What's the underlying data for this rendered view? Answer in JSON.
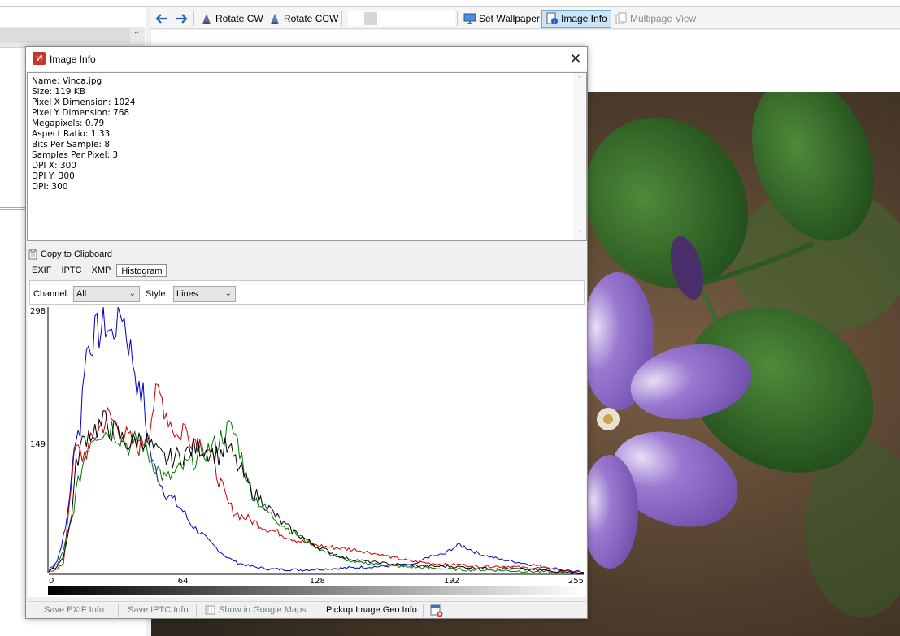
{
  "toolbar": {
    "back_icon": "arrow-left-icon",
    "forward_icon": "arrow-right-icon",
    "rotate_cw": "Rotate CW",
    "rotate_ccw": "Rotate CCW",
    "set_wallpaper": "Set Wallpaper",
    "image_info": "Image Info",
    "multipage_view": "Multipage View",
    "scroll_left": "<",
    "scroll_right": ">"
  },
  "dialog": {
    "title": "Image Info",
    "close_glyph": "✕",
    "info_lines": [
      "Name: Vinca.jpg",
      "Size: 119 KB",
      "Pixel X Dimension: 1024",
      "Pixel Y Dimension: 768",
      "Megapixels: 0.79",
      "Aspect Ratio: 1.33",
      "Bits Per Sample: 8",
      "Samples Per Pixel: 3",
      "DPI X: 300",
      "DPI Y: 300",
      "DPI: 300"
    ],
    "copy_to_clipboard": "Copy to Clipboard",
    "tabs": [
      "EXIF",
      "IPTC",
      "XMP",
      "Histogram"
    ],
    "active_tab": "Histogram",
    "channel_label": "Channel:",
    "channel_value": "All",
    "style_label": "Style:",
    "style_value": "Lines",
    "footer": {
      "save_exif": "Save EXIF Info",
      "save_iptc": "Save IPTC Info",
      "show_maps": "Show in Google Maps",
      "pickup_geo": "Pickup Image Geo Info"
    }
  },
  "chart_data": {
    "type": "line",
    "title": "",
    "xlabel": "",
    "ylabel": "",
    "xlim": [
      0,
      255
    ],
    "ylim": [
      0,
      298
    ],
    "x_ticks": [
      "0",
      "64",
      "128",
      "192",
      "255"
    ],
    "y_ticks": [
      "298",
      "149"
    ],
    "grid": false,
    "series": [
      {
        "color": "#0000cc",
        "points": [
          [
            0,
            4
          ],
          [
            4,
            14
          ],
          [
            8,
            50
          ],
          [
            11,
            110
          ],
          [
            13,
            160
          ],
          [
            15,
            160
          ],
          [
            17,
            240
          ],
          [
            19,
            255
          ],
          [
            21,
            265
          ],
          [
            24,
            270
          ],
          [
            27,
            280
          ],
          [
            30,
            265
          ],
          [
            33,
            290
          ],
          [
            35,
            296
          ],
          [
            37,
            270
          ],
          [
            39,
            250
          ],
          [
            41,
            230
          ],
          [
            43,
            200
          ],
          [
            45,
            200
          ],
          [
            46,
            170
          ],
          [
            48,
            140
          ],
          [
            50,
            120
          ],
          [
            52,
            110
          ],
          [
            54,
            98
          ],
          [
            56,
            90
          ],
          [
            60,
            80
          ],
          [
            64,
            70
          ],
          [
            67,
            58
          ],
          [
            70,
            50
          ],
          [
            73,
            44
          ],
          [
            76,
            36
          ],
          [
            80,
            28
          ],
          [
            85,
            18
          ],
          [
            90,
            12
          ],
          [
            96,
            8
          ],
          [
            105,
            5
          ],
          [
            120,
            4
          ],
          [
            140,
            6
          ],
          [
            160,
            8
          ],
          [
            175,
            10
          ],
          [
            180,
            18
          ],
          [
            185,
            20
          ],
          [
            189,
            22
          ],
          [
            192,
            28
          ],
          [
            196,
            32
          ],
          [
            200,
            28
          ],
          [
            205,
            22
          ],
          [
            215,
            16
          ],
          [
            225,
            12
          ],
          [
            235,
            8
          ],
          [
            245,
            4
          ],
          [
            252,
            2
          ],
          [
            255,
            0
          ]
        ]
      },
      {
        "color": "#cc0000",
        "points": [
          [
            0,
            2
          ],
          [
            4,
            6
          ],
          [
            7,
            10
          ],
          [
            9,
            60
          ],
          [
            11,
            110
          ],
          [
            13,
            140
          ],
          [
            16,
            130
          ],
          [
            19,
            140
          ],
          [
            22,
            155
          ],
          [
            25,
            165
          ],
          [
            28,
            175
          ],
          [
            31,
            170
          ],
          [
            34,
            160
          ],
          [
            38,
            150
          ],
          [
            42,
            140
          ],
          [
            46,
            150
          ],
          [
            48,
            165
          ],
          [
            50,
            190
          ],
          [
            52,
            200
          ],
          [
            54,
            195
          ],
          [
            56,
            180
          ],
          [
            58,
            170
          ],
          [
            60,
            160
          ],
          [
            62,
            150
          ],
          [
            64,
            165
          ],
          [
            67,
            155
          ],
          [
            70,
            150
          ],
          [
            73,
            145
          ],
          [
            76,
            140
          ],
          [
            79,
            120
          ],
          [
            82,
            100
          ],
          [
            85,
            80
          ],
          [
            88,
            70
          ],
          [
            92,
            64
          ],
          [
            96,
            60
          ],
          [
            100,
            55
          ],
          [
            104,
            50
          ],
          [
            110,
            45
          ],
          [
            115,
            40
          ],
          [
            120,
            36
          ],
          [
            126,
            32
          ],
          [
            132,
            30
          ],
          [
            140,
            28
          ],
          [
            148,
            26
          ],
          [
            156,
            22
          ],
          [
            164,
            18
          ],
          [
            172,
            14
          ],
          [
            180,
            12
          ],
          [
            188,
            10
          ],
          [
            196,
            10
          ],
          [
            204,
            8
          ],
          [
            212,
            8
          ],
          [
            220,
            8
          ],
          [
            228,
            6
          ],
          [
            236,
            6
          ],
          [
            244,
            4
          ],
          [
            255,
            0
          ]
        ]
      },
      {
        "color": "#007700",
        "points": [
          [
            0,
            2
          ],
          [
            4,
            10
          ],
          [
            7,
            25
          ],
          [
            9,
            45
          ],
          [
            11,
            60
          ],
          [
            13,
            90
          ],
          [
            15,
            110
          ],
          [
            18,
            140
          ],
          [
            21,
            155
          ],
          [
            24,
            160
          ],
          [
            27,
            158
          ],
          [
            30,
            165
          ],
          [
            33,
            155
          ],
          [
            36,
            148
          ],
          [
            39,
            140
          ],
          [
            42,
            150
          ],
          [
            45,
            145
          ],
          [
            48,
            130
          ],
          [
            51,
            120
          ],
          [
            54,
            110
          ],
          [
            56,
            105
          ],
          [
            59,
            110
          ],
          [
            62,
            115
          ],
          [
            65,
            120
          ],
          [
            68,
            125
          ],
          [
            71,
            130
          ],
          [
            74,
            135
          ],
          [
            77,
            140
          ],
          [
            80,
            145
          ],
          [
            83,
            155
          ],
          [
            86,
            162
          ],
          [
            89,
            155
          ],
          [
            92,
            130
          ],
          [
            95,
            100
          ],
          [
            98,
            85
          ],
          [
            102,
            75
          ],
          [
            106,
            65
          ],
          [
            110,
            58
          ],
          [
            114,
            50
          ],
          [
            118,
            44
          ],
          [
            122,
            38
          ],
          [
            126,
            32
          ],
          [
            130,
            26
          ],
          [
            134,
            22
          ],
          [
            138,
            18
          ],
          [
            142,
            15
          ],
          [
            146,
            12
          ],
          [
            150,
            12
          ],
          [
            158,
            10
          ],
          [
            166,
            8
          ],
          [
            174,
            7
          ],
          [
            182,
            6
          ],
          [
            190,
            5
          ],
          [
            200,
            4
          ],
          [
            210,
            4
          ],
          [
            220,
            3
          ],
          [
            235,
            2
          ],
          [
            255,
            0
          ]
        ]
      },
      {
        "color": "#000000",
        "points": [
          [
            0,
            2
          ],
          [
            4,
            8
          ],
          [
            7,
            20
          ],
          [
            9,
            40
          ],
          [
            11,
            70
          ],
          [
            13,
            120
          ],
          [
            15,
            140
          ],
          [
            18,
            155
          ],
          [
            21,
            160
          ],
          [
            24,
            165
          ],
          [
            27,
            170
          ],
          [
            30,
            160
          ],
          [
            33,
            155
          ],
          [
            36,
            148
          ],
          [
            39,
            145
          ],
          [
            42,
            150
          ],
          [
            45,
            152
          ],
          [
            48,
            145
          ],
          [
            51,
            135
          ],
          [
            54,
            130
          ],
          [
            57,
            128
          ],
          [
            60,
            130
          ],
          [
            63,
            132
          ],
          [
            66,
            135
          ],
          [
            69,
            140
          ],
          [
            72,
            142
          ],
          [
            75,
            138
          ],
          [
            78,
            135
          ],
          [
            81,
            132
          ],
          [
            84,
            140
          ],
          [
            87,
            135
          ],
          [
            90,
            120
          ],
          [
            93,
            110
          ],
          [
            96,
            95
          ],
          [
            100,
            85
          ],
          [
            104,
            75
          ],
          [
            108,
            65
          ],
          [
            112,
            55
          ],
          [
            116,
            48
          ],
          [
            120,
            42
          ],
          [
            124,
            36
          ],
          [
            128,
            30
          ],
          [
            132,
            26
          ],
          [
            136,
            22
          ],
          [
            140,
            18
          ],
          [
            144,
            16
          ],
          [
            150,
            14
          ],
          [
            158,
            12
          ],
          [
            166,
            10
          ],
          [
            174,
            9
          ],
          [
            182,
            8
          ],
          [
            190,
            8
          ],
          [
            198,
            7
          ],
          [
            206,
            6
          ],
          [
            214,
            6
          ],
          [
            222,
            5
          ],
          [
            230,
            4
          ],
          [
            240,
            3
          ],
          [
            255,
            0
          ]
        ]
      }
    ]
  }
}
